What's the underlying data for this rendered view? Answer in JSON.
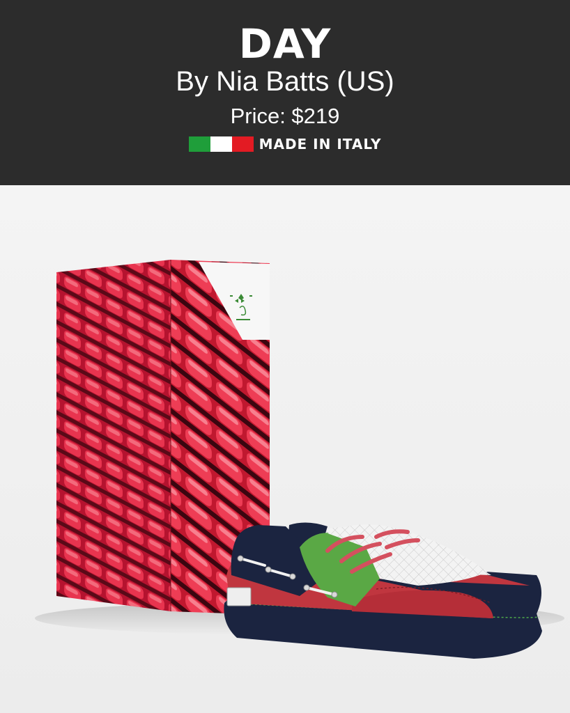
{
  "product": {
    "name": "DAY",
    "byline": "By Nia Batts (US)",
    "price": "Price: $219",
    "origin_label": "MADE IN ITALY"
  },
  "colors": {
    "header_bg": "#2c2c2c",
    "flag_green": "#1f9e3a",
    "flag_white": "#ffffff",
    "flag_red": "#e31b23",
    "box_pattern": "#d6213f",
    "shoe_red": "#c0363f",
    "shoe_navy": "#1b2440",
    "shoe_green": "#5aa845",
    "laces": "#d4505e"
  },
  "icons": {
    "flag": "italy-flag-icon"
  }
}
